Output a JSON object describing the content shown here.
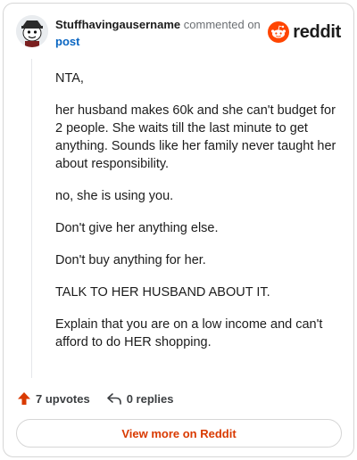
{
  "comment": {
    "username": "Stuffhavingausername",
    "action_text": "commented on",
    "post_link": "post",
    "paragraphs": [
      "NTA,",
      "her husband makes 60k and she can't budget for 2 people. She waits till the last minute to get anything. Sounds like her family never taught her about responsibility.",
      "no, she is using you.",
      "Don't give her anything else.",
      "Don't buy anything for her.",
      "TALK TO HER HUSBAND ABOUT IT.",
      "Explain that you are on a low income and can't afford to do HER shopping."
    ]
  },
  "brand": {
    "wordmark": "reddit",
    "color": "#ff4500"
  },
  "actions": {
    "upvotes": "7 upvotes",
    "replies": "0 replies",
    "upvote_icon": "upvote-arrow-icon",
    "reply_icon": "reply-arrow-icon",
    "upvote_color": "#d93a00"
  },
  "footer": {
    "view_more": "View more on Reddit"
  }
}
